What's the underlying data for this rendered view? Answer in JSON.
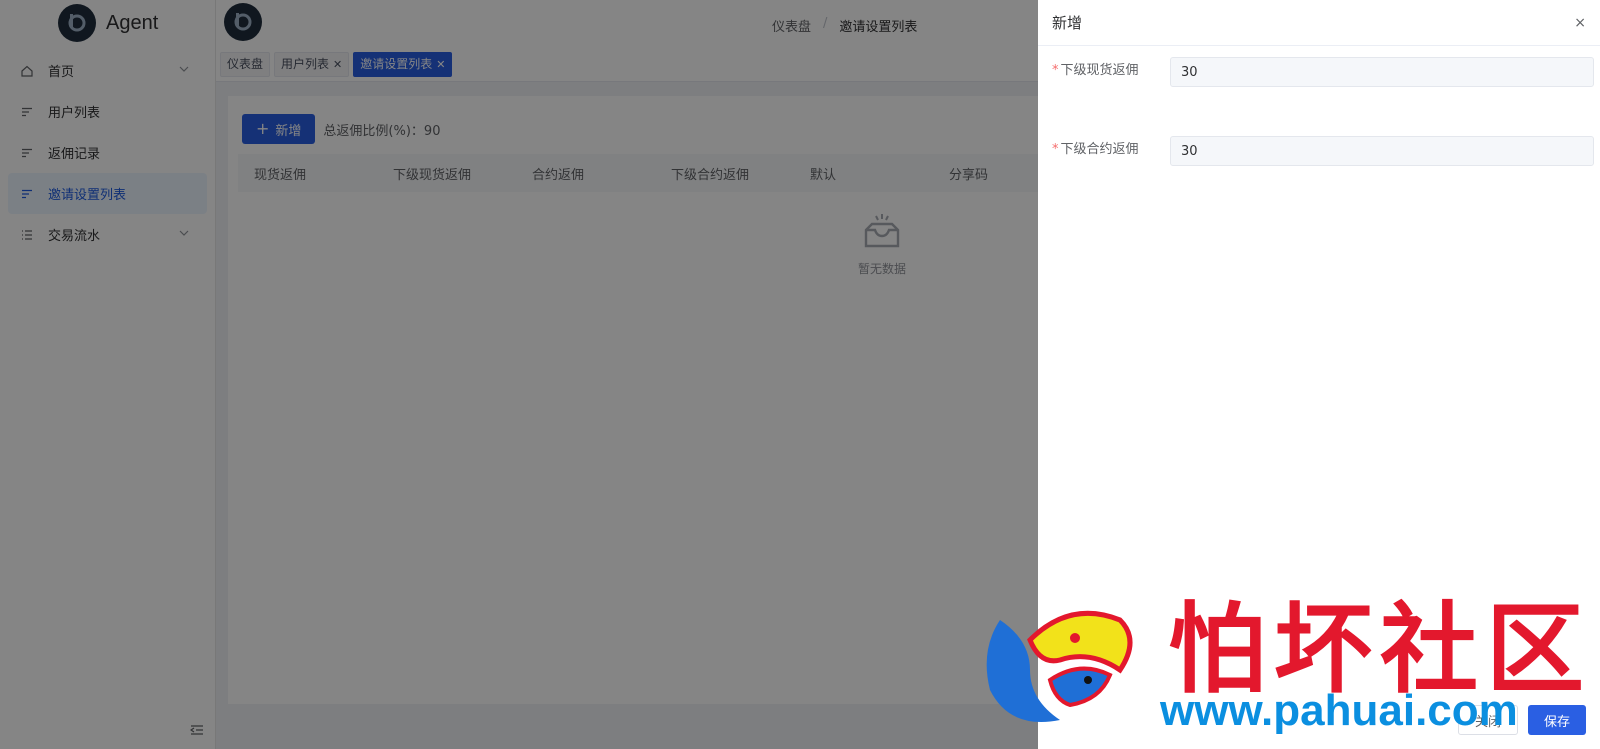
{
  "app": {
    "name": "Agent"
  },
  "sidebar": {
    "items": [
      {
        "label": "首页",
        "icon": "home-icon",
        "has_children": true
      },
      {
        "label": "用户列表",
        "icon": "list-icon",
        "has_children": false
      },
      {
        "label": "返佣记录",
        "icon": "list-icon",
        "has_children": false
      },
      {
        "label": "邀请设置列表",
        "icon": "list-icon",
        "has_children": false,
        "active": true
      },
      {
        "label": "交易流水",
        "icon": "menu-icon",
        "has_children": true
      }
    ]
  },
  "header": {
    "breadcrumb": [
      "仪表盘",
      "邀请设置列表"
    ]
  },
  "tabs": [
    {
      "label": "仪表盘",
      "closable": false
    },
    {
      "label": "用户列表",
      "closable": true
    },
    {
      "label": "邀请设置列表",
      "closable": true,
      "active": true
    }
  ],
  "main": {
    "add_label": "新增",
    "total_label": "总返佣比例(%)：90",
    "columns": [
      "现货返佣",
      "下级现货返佣",
      "合约返佣",
      "下级合约返佣",
      "默认",
      "分享码"
    ],
    "empty_text": "暂无数据"
  },
  "drawer": {
    "title": "新增",
    "close": "×",
    "fields": [
      {
        "label": "下级现货返佣",
        "value": "30",
        "required": true
      },
      {
        "label": "下级合约返佣",
        "value": "30",
        "required": true
      }
    ],
    "cancel_label": "关闭",
    "save_label": "保存"
  },
  "watermark": {
    "text": "怕坏社区",
    "url": "www.pahuai.com"
  },
  "colors": {
    "primary": "#2a5fe3",
    "required": "#f56c6c",
    "watermark_red": "#e3182d",
    "watermark_blue": "#0b8fe0"
  }
}
